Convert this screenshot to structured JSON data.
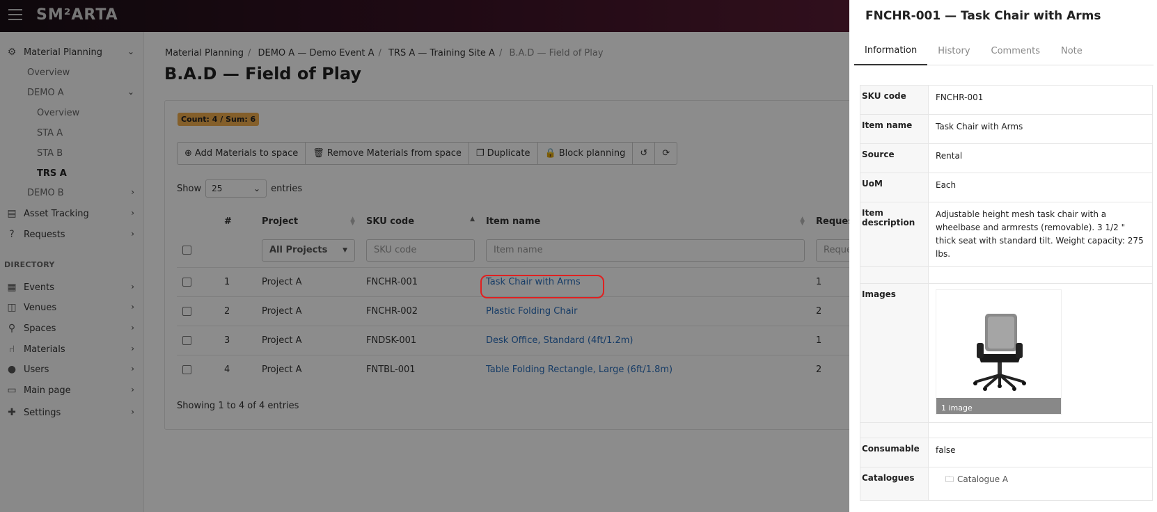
{
  "app": {
    "logo": "SM²ARTA"
  },
  "sidebar": {
    "material_planning": "Material Planning",
    "overview": "Overview",
    "demo_a": "DEMO A",
    "demo_a_overview": "Overview",
    "sta_a": "STA A",
    "sta_b": "STA B",
    "trs_a": "TRS A",
    "demo_b": "DEMO B",
    "asset_tracking": "Asset Tracking",
    "requests": "Requests",
    "directory_heading": "DIRECTORY",
    "events": "Events",
    "venues": "Venues",
    "spaces": "Spaces",
    "materials": "Materials",
    "users": "Users",
    "main_page": "Main page",
    "settings": "Settings"
  },
  "breadcrumb": {
    "items": [
      "Material Planning",
      "DEMO A — Demo Event A",
      "TRS A — Training Site A"
    ],
    "current": "B.A.D — Field of Play"
  },
  "page": {
    "title": "B.A.D — Field of Play",
    "badge": "Count: 4 / Sum: 6"
  },
  "toolbar": {
    "add": "Add Materials to space",
    "remove": "Remove Materials from space",
    "duplicate": "Duplicate",
    "block": "Block planning"
  },
  "show_entries": {
    "show": "Show",
    "value": "25",
    "entries": "entries"
  },
  "table": {
    "headers": {
      "num": "#",
      "project": "Project",
      "sku": "SKU code",
      "item": "Item name",
      "requested": "Request"
    },
    "filters": {
      "project": "All Projects",
      "sku": "SKU code",
      "item": "Item name",
      "requested": "Reque"
    },
    "rows": [
      {
        "num": "1",
        "project": "Project A",
        "sku": "FNCHR-001",
        "item": "Task Chair with Arms",
        "qty": "1"
      },
      {
        "num": "2",
        "project": "Project A",
        "sku": "FNCHR-002",
        "item": "Plastic Folding Chair",
        "qty": "2"
      },
      {
        "num": "3",
        "project": "Project A",
        "sku": "FNDSK-001",
        "item": "Desk Office, Standard (4ft/1.2m)",
        "qty": "1"
      },
      {
        "num": "4",
        "project": "Project A",
        "sku": "FNTBL-001",
        "item": "Table Folding Rectangle, Large (6ft/1.8m)",
        "qty": "2"
      }
    ],
    "footer": "Showing 1 to 4 of 4 entries"
  },
  "panel": {
    "title": "FNCHR-001 — Task Chair with Arms",
    "tabs": [
      "Information",
      "History",
      "Comments",
      "Note"
    ],
    "fields": {
      "sku_label": "SKU code",
      "sku": "FNCHR-001",
      "name_label": "Item name",
      "name": "Task Chair with Arms",
      "source_label": "Source",
      "source": "Rental",
      "uom_label": "UoM",
      "uom": "Each",
      "desc_label": "Item description",
      "desc": "Adjustable height mesh task chair with a wheelbase and armrests (removable). 3 1/2 \" thick seat with standard tilt. Weight capacity: 275 lbs.",
      "images_label": "Images",
      "images_caption": "1 image",
      "consumable_label": "Consumable",
      "consumable": "false",
      "catalogues_label": "Catalogues",
      "catalogue": "Catalogue A"
    }
  }
}
